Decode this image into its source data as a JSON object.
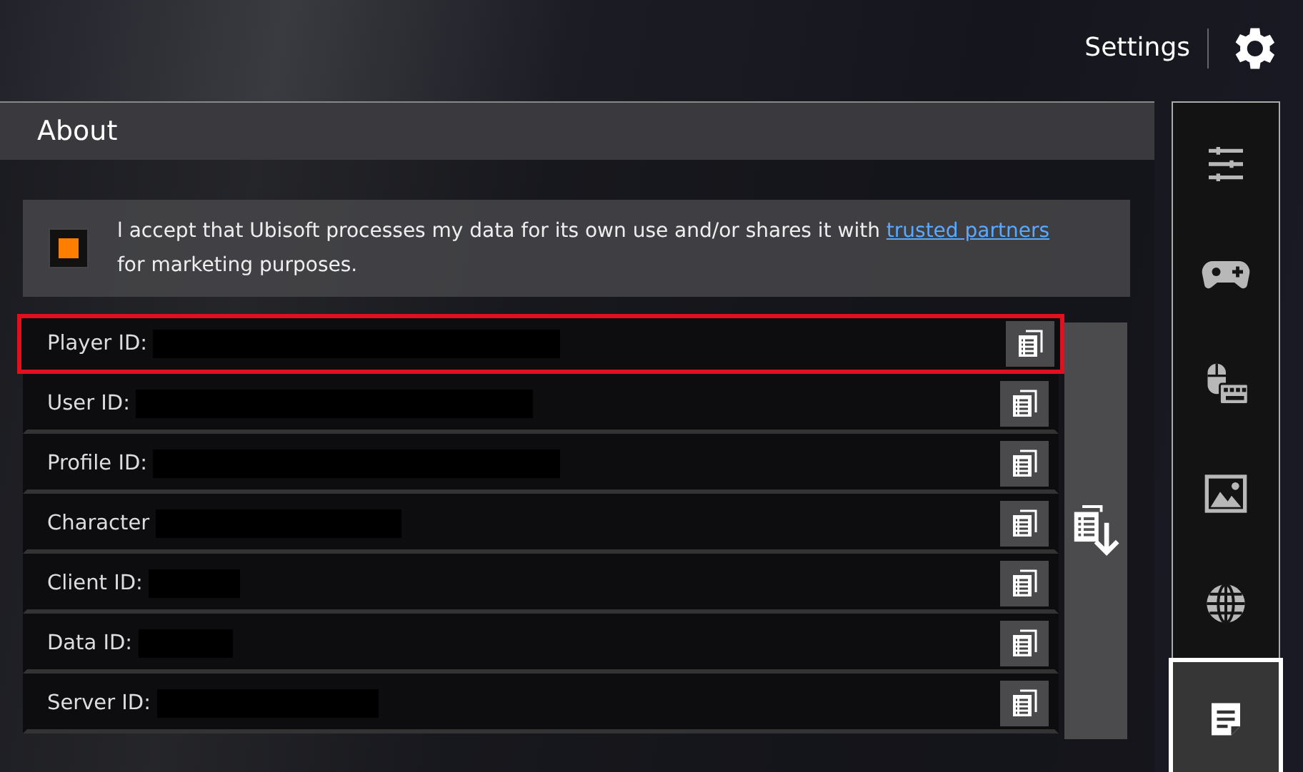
{
  "header": {
    "title": "Settings"
  },
  "section": {
    "title": "About"
  },
  "consent": {
    "checked": true,
    "text": "l accept that Ubisoft processes my data for its own use and/or shares it with ",
    "link": "trusted partners",
    "text_after": "for marketing purposes."
  },
  "id_rows": [
    {
      "label": "Player ID:",
      "selected": true
    },
    {
      "label": "User ID:",
      "selected": false
    },
    {
      "label": "Profile ID:",
      "selected": false
    },
    {
      "label": "Character",
      "selected": false
    },
    {
      "label": "Client ID:",
      "selected": false
    },
    {
      "label": "Data ID:",
      "selected": false
    },
    {
      "label": "Server ID:",
      "selected": false
    }
  ],
  "sidebar": {
    "items": [
      {
        "kind": "sliders",
        "selected": false
      },
      {
        "kind": "gamepad",
        "selected": false
      },
      {
        "kind": "mouse-keyboard",
        "selected": false
      },
      {
        "kind": "image",
        "selected": false
      },
      {
        "kind": "globe",
        "selected": false
      },
      {
        "kind": "document",
        "selected": true
      }
    ]
  }
}
